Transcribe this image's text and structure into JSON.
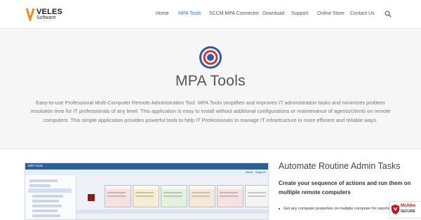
{
  "header": {
    "logo": {
      "brand_main": "VELES",
      "brand_sub": "Software"
    },
    "nav": [
      {
        "label": "Home",
        "active": false
      },
      {
        "label": "MPA Tools",
        "active": true
      },
      {
        "label": "SCCM MPA Connector",
        "active": false
      },
      {
        "label": "Download",
        "active": false
      },
      {
        "label": "Support",
        "active": false
      },
      {
        "label": "Online Store",
        "active": false
      },
      {
        "label": "Contact Us",
        "active": false
      }
    ],
    "search_icon": "search-icon"
  },
  "hero": {
    "icon": "target-icon",
    "title": "MPA Tools",
    "description": "Easy-to-use Professional Multi-Computer Remote Administration Tool. MPA Tools simplifies and improves IT administration tasks and minimizes problem resolution time for IT professionals of any level. This application is easy to install without additional configurations or maintenance of agents/clients on remote computers. This simple application provides powerful tools to help IT Professionals to manage IT infrastructure in more efficient and reliable ways."
  },
  "feature": {
    "screenshot": {
      "window_title": "MPA Tools",
      "menu": [
        "About",
        "Support"
      ]
    },
    "heading": "Automate Routine Admin Tasks",
    "subheading": "Create your sequence of actions and run them on multiple remote computers",
    "bullets": [
      "Get any computer properties on multiple computer for reports"
    ]
  },
  "badge": {
    "line1": "McAfee",
    "line2": "SECURE"
  },
  "colors": {
    "accent": "#3b73c4",
    "hero_bg": "#f6f6f6",
    "target_red": "#d9302c",
    "target_blue": "#2a5aa8"
  }
}
